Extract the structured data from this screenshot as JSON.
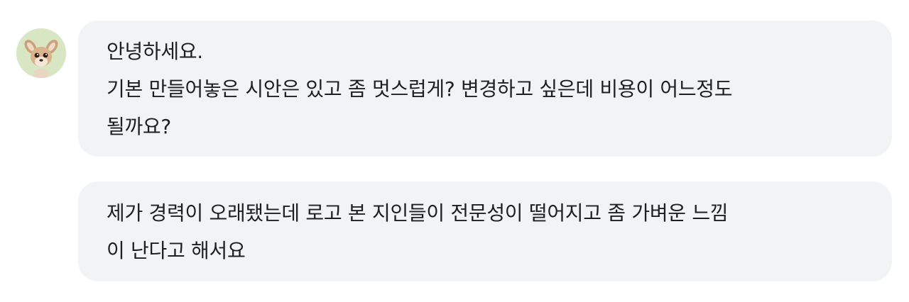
{
  "messages": [
    {
      "lines": [
        "안녕하세요.",
        "기본 만들어놓은 시안은 있고 좀 멋스럽게? 변경하고 싶은데 비용이 어느정도",
        "될까요?"
      ]
    },
    {
      "lines": [
        "제가 경력이 오래됐는데 로고 본 지인들이 전문성이 떨어지고 좀 가벼운 느낌",
        "이 난다고 해서요"
      ]
    }
  ],
  "avatar": {
    "icon": "fawn-avatar-icon",
    "background": "#d8e6c4"
  },
  "colors": {
    "bubble_bg": "#f2f3f5",
    "text": "#1f1f1f"
  }
}
